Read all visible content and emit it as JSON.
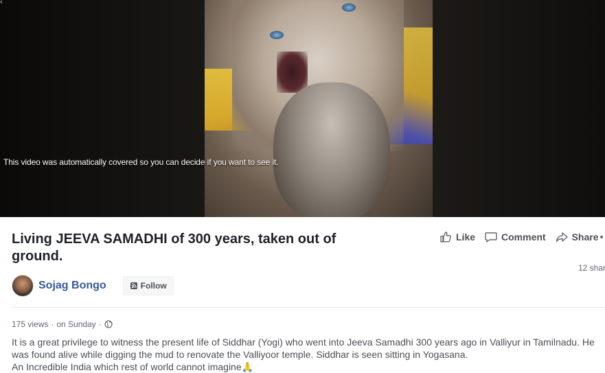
{
  "video": {
    "notice": "This video was automatically covered so you can decide if you want to see it."
  },
  "post": {
    "title": "Living JEEVA SAMADHI of 300 years, taken out of ground."
  },
  "actions": {
    "like_label": "Like",
    "comment_label": "Comment",
    "share_label": "Share"
  },
  "shares_count": "12 shar",
  "author": {
    "name": "Sojag Bongo",
    "follow_label": "Follow"
  },
  "meta": {
    "views": "175 views",
    "separator": "·",
    "date": "on Sunday",
    "separator2": "·",
    "privacy_icon": "globe-icon"
  },
  "description": {
    "line1": "It is a great privilege to witness the present life of Siddhar (Yogi) who went into Jeeva Samadhi 300 years ago in Valliyur in Tamilnadu. He was found alive while digging the mud to renovate the Valliyoor temple. Siddhar is seen sitting in Yogasana.",
    "line2": "An Incredible India which rest of world cannot imagine",
    "emoji": "🙏"
  },
  "colors": {
    "link_blue": "#365899",
    "action_gray": "#4b4f56",
    "meta_gray": "#606770"
  }
}
